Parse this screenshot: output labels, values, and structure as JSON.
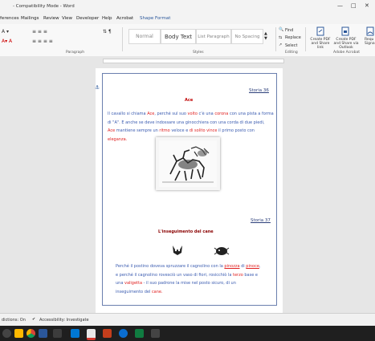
{
  "window": {
    "title": "- Compatibility Mode - Word"
  },
  "menu": {
    "items": [
      "ferences",
      "Mailings",
      "Review",
      "View",
      "Developer",
      "Help",
      "Acrobat",
      "Shape Format"
    ]
  },
  "ribbon": {
    "styles": [
      "Normal",
      "Body Text",
      "List Paragraph",
      "No Spacing"
    ],
    "find_label": "Find",
    "replace_label": "Replace",
    "select_label": "Select",
    "pdf_share_label": "Create PDF and Share link",
    "pdf_outlook_label": "Create PDF and Share via Outlook",
    "sign_label": "Requ Signa",
    "group_paragraph": "Paragraph",
    "group_styles": "Styles",
    "group_editing": "Editing",
    "group_acrobat": "Adobe Acrobat"
  },
  "document": {
    "story1": {
      "number": "Storia 36",
      "title": "Ace",
      "lines": [
        [
          {
            "t": "Il cavallo si chiama "
          },
          {
            "t": "Ace",
            "r": 1
          },
          {
            "t": ", perché sul suo "
          },
          {
            "t": "volto",
            "r": 1
          },
          {
            "t": " c'è una "
          },
          {
            "t": "corona",
            "r": 1
          },
          {
            "t": " con una pista a forma"
          }
        ],
        [
          {
            "t": "di \"A\". E anche se deve indossare una ginocchiera con una corda di due piedi,"
          }
        ],
        [
          {
            "t": "Ace",
            "r": 1
          },
          {
            "t": " mantiene sempre un "
          },
          {
            "t": "ritmo",
            "r": 1
          },
          {
            "t": " veloce e "
          },
          {
            "t": "di solito vince",
            "r": 1
          },
          {
            "t": " il primo posto con"
          }
        ],
        [
          {
            "t": "eleganza.",
            "r": 1
          }
        ]
      ]
    },
    "story2": {
      "number": "Storia 37",
      "title": "L'inseguimento del cane",
      "lines": [
        [
          {
            "t": "Perché il postino doveva spruzzare il cagnolino con la "
          },
          {
            "t": "pinozza",
            "r": 1,
            "u": 1
          },
          {
            "t": " di "
          },
          {
            "t": "pinoce",
            "r": 1,
            "u": 1
          },
          {
            "t": ","
          }
        ],
        [
          {
            "t": "e perché il cagnolino rovesciò un vaso di fiori, rosicchiò la "
          },
          {
            "t": "terzo",
            "r": 1
          },
          {
            "t": " base e"
          }
        ],
        [
          {
            "t": "una "
          },
          {
            "t": "valigetta",
            "r": 1
          },
          {
            "t": " - il suo padrone la mise nel posto sicuro, di un"
          }
        ],
        [
          {
            "t": "inseguimento del "
          },
          {
            "t": "cane.",
            "r": 1
          }
        ]
      ]
    }
  },
  "status": {
    "left": "dictions: On",
    "accessibility": "Accessibility: Investigate"
  },
  "colors": {
    "accent": "#2b579a",
    "body_text": "#3a5bb0",
    "highlight": "#e02020",
    "heading": "#c00000"
  }
}
